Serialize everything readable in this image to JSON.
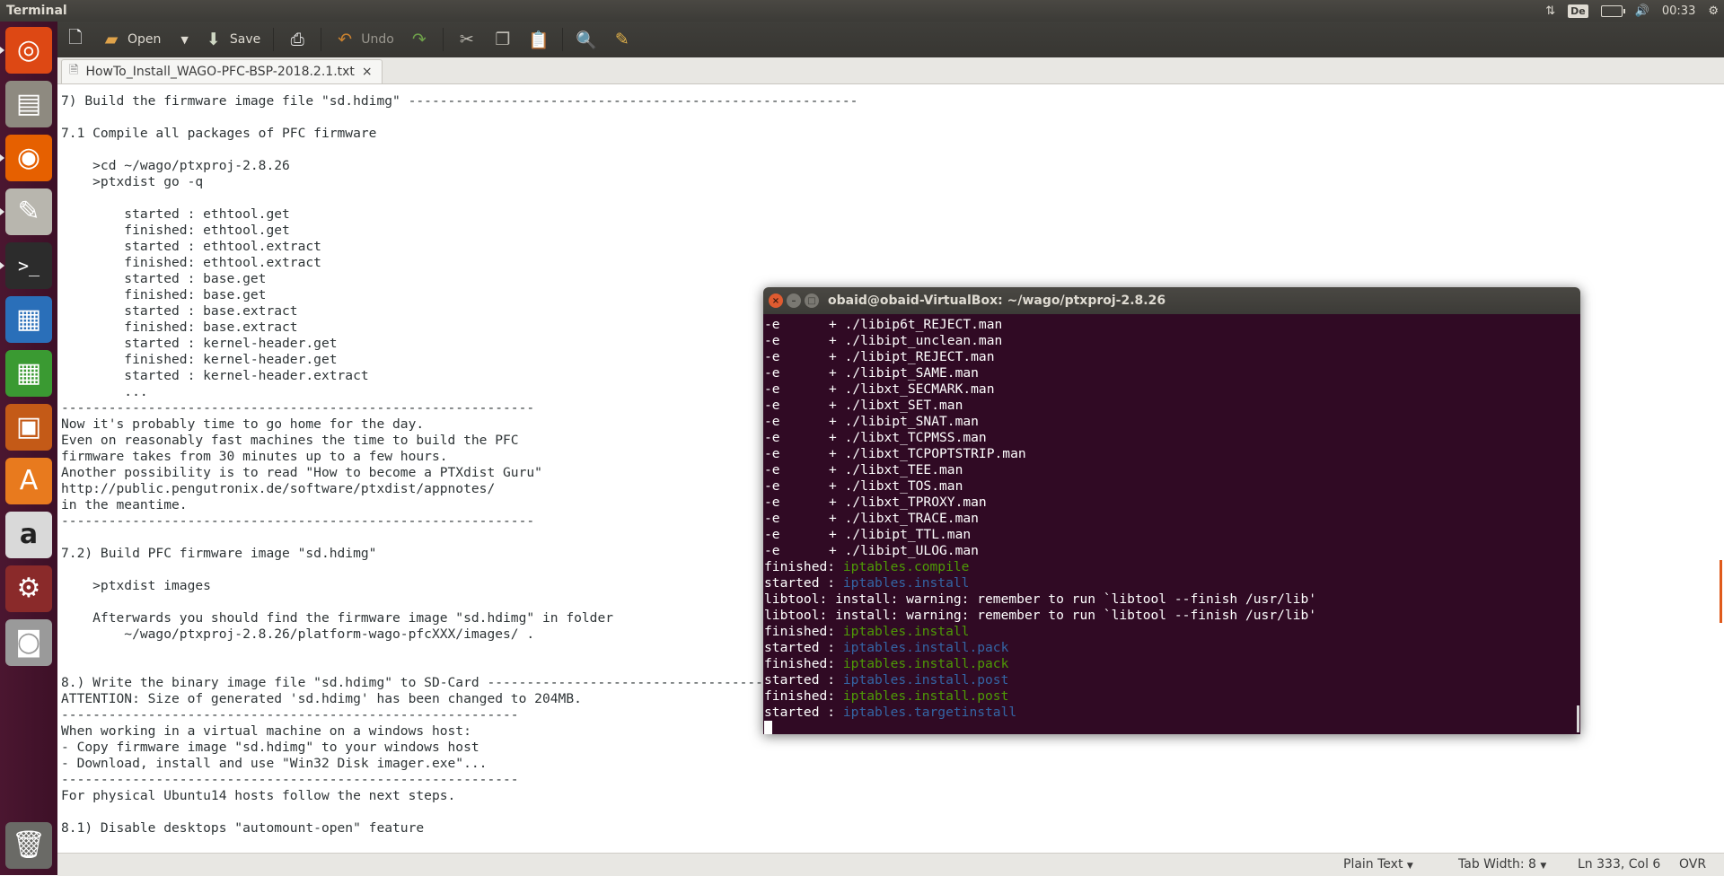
{
  "top_panel": {
    "title": "Terminal",
    "keyboard_layout": "De",
    "clock": "00:33"
  },
  "launcher": {
    "items": [
      {
        "name": "ubuntu-dash-icon",
        "glyph": "◎",
        "bg": "#dd4814"
      },
      {
        "name": "files-icon",
        "glyph": "▤",
        "bg": "#8e8a80"
      },
      {
        "name": "firefox-icon",
        "glyph": "◉",
        "bg": "#e66000"
      },
      {
        "name": "text-editor-icon",
        "glyph": "✎",
        "bg": "#b8b6ae"
      },
      {
        "name": "terminal-icon",
        "glyph": ">_",
        "bg": "#2c2c2c"
      },
      {
        "name": "writer-icon",
        "glyph": "▦",
        "bg": "#2a6fb9"
      },
      {
        "name": "calc-icon",
        "glyph": "▦",
        "bg": "#3a9a32"
      },
      {
        "name": "impress-icon",
        "glyph": "▣",
        "bg": "#c45a17"
      },
      {
        "name": "software-center-icon",
        "glyph": "A",
        "bg": "#e87a1e"
      },
      {
        "name": "amazon-icon",
        "glyph": "a",
        "bg": "#d9d9d9"
      },
      {
        "name": "system-settings-icon",
        "glyph": "⚙",
        "bg": "#8a2a2a"
      },
      {
        "name": "camera-icon",
        "glyph": "◙",
        "bg": "#9a9a9a"
      },
      {
        "name": "trash-icon",
        "glyph": "🗑",
        "bg": "#6a6a66"
      }
    ]
  },
  "toolbar": {
    "open_label": "Open",
    "save_label": "Save",
    "undo_label": "Undo"
  },
  "tab": {
    "filename": "HowTo_Install_WAGO-PFC-BSP-2018.2.1.txt",
    "close": "×"
  },
  "editor_lines": [
    "7) Build the firmware image file \"sd.hdimg\" ---------------------------------------------------------",
    "",
    "7.1 Compile all packages of PFC firmware",
    "",
    "    >cd ~/wago/ptxproj-2.8.26",
    "    >ptxdist go -q",
    "",
    "        started : ethtool.get",
    "        finished: ethtool.get",
    "        started : ethtool.extract",
    "        finished: ethtool.extract",
    "        started : base.get",
    "        finished: base.get",
    "        started : base.extract",
    "        finished: base.extract",
    "        started : kernel-header.get",
    "        finished: kernel-header.get",
    "        started : kernel-header.extract",
    "        ...",
    "------------------------------------------------------------",
    "Now it's probably time to go home for the day.",
    "Even on reasonably fast machines the time to build the PFC",
    "firmware takes from 30 minutes up to a few hours.",
    "Another possibility is to read \"How to become a PTXdist Guru\"",
    "http://public.pengutronix.de/software/ptxdist/appnotes/",
    "in the meantime.",
    "------------------------------------------------------------",
    "",
    "7.2) Build PFC firmware image \"sd.hdimg\"",
    "",
    "    >ptxdist images",
    "",
    "    Afterwards you should find the firmware image \"sd.hdimg\" in folder",
    "        ~/wago/ptxproj-2.8.26/platform-wago-pfcXXX/images/ .",
    "",
    "",
    "8.) Write the binary image file \"sd.hdimg\" to SD-Card ---------------------------------------------------",
    "ATTENTION: Size of generated 'sd.hdimg' has been changed to 204MB.",
    "----------------------------------------------------------",
    "When working in a virtual machine on a windows host:",
    "- Copy firmware image \"sd.hdimg\" to your windows host",
    "- Download, install and use \"Win32 Disk imager.exe\"...",
    "----------------------------------------------------------",
    "For physical Ubuntu14 hosts follow the next steps.",
    "",
    "8.1) Disable desktops \"automount-open\" feature"
  ],
  "statusbar": {
    "syntax": "Plain Text",
    "tab_width": "Tab Width: 8",
    "position": "Ln 333, Col 6",
    "mode": "OVR"
  },
  "terminal": {
    "title": "obaid@obaid-VirtualBox: ~/wago/ptxproj-2.8.26",
    "lines": [
      {
        "a": "-e",
        "b": "+ ./libip6t_REJECT.man"
      },
      {
        "a": "-e",
        "b": "+ ./libipt_unclean.man"
      },
      {
        "a": "-e",
        "b": "+ ./libipt_REJECT.man"
      },
      {
        "a": "-e",
        "b": "+ ./libipt_SAME.man"
      },
      {
        "a": "-e",
        "b": "+ ./libxt_SECMARK.man"
      },
      {
        "a": "-e",
        "b": "+ ./libxt_SET.man"
      },
      {
        "a": "-e",
        "b": "+ ./libipt_SNAT.man"
      },
      {
        "a": "-e",
        "b": "+ ./libxt_TCPMSS.man"
      },
      {
        "a": "-e",
        "b": "+ ./libxt_TCPOPTSTRIP.man"
      },
      {
        "a": "-e",
        "b": "+ ./libxt_TEE.man"
      },
      {
        "a": "-e",
        "b": "+ ./libxt_TOS.man"
      },
      {
        "a": "-e",
        "b": "+ ./libxt_TPROXY.man"
      },
      {
        "a": "-e",
        "b": "+ ./libxt_TRACE.man"
      },
      {
        "a": "-e",
        "b": "+ ./libipt_TTL.man"
      },
      {
        "a": "-e",
        "b": "+ ./libipt_ULOG.man"
      }
    ],
    "status_lines": [
      {
        "prefix": "finished: ",
        "target": "iptables.compile",
        "color": "green"
      },
      {
        "prefix": "started : ",
        "target": "iptables.install",
        "color": "blue"
      },
      {
        "text": "libtool: install: warning: remember to run `libtool --finish /usr/lib'"
      },
      {
        "text": "libtool: install: warning: remember to run `libtool --finish /usr/lib'"
      },
      {
        "prefix": "finished: ",
        "target": "iptables.install",
        "color": "green"
      },
      {
        "prefix": "started : ",
        "target": "iptables.install.pack",
        "color": "blue"
      },
      {
        "prefix": "finished: ",
        "target": "iptables.install.pack",
        "color": "green"
      },
      {
        "prefix": "started : ",
        "target": "iptables.install.post",
        "color": "blue"
      },
      {
        "prefix": "finished: ",
        "target": "iptables.install.post",
        "color": "green"
      },
      {
        "prefix": "started : ",
        "target": "iptables.targetinstall",
        "color": "blue"
      }
    ]
  },
  "colors": {
    "terminal_bg": "#300a24",
    "term_green": "#4e9a06",
    "term_blue": "#3465a4",
    "launcher_bg": "#4b1630"
  }
}
